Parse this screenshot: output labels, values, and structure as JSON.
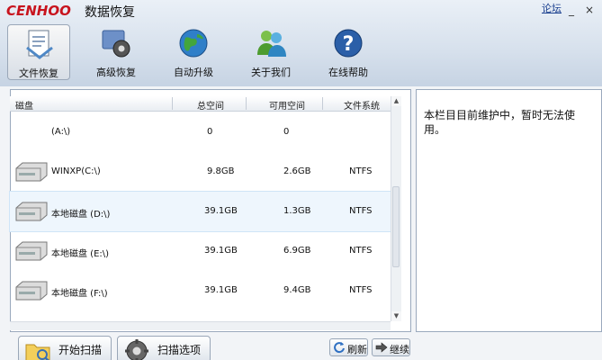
{
  "window": {
    "title": "数据恢复",
    "forum_link": "论坛",
    "logo_text": "CENHOO"
  },
  "window_controls": {
    "minimize": "_",
    "close": "×"
  },
  "toolbar": [
    {
      "label": "文件恢复",
      "icon": "file-recovery-icon",
      "active": true
    },
    {
      "label": "高级恢复",
      "icon": "gear-recovery-icon",
      "active": false
    },
    {
      "label": "自动升级",
      "icon": "globe-icon",
      "active": false
    },
    {
      "label": "关于我们",
      "icon": "users-icon",
      "active": false
    },
    {
      "label": "在线帮助",
      "icon": "help-icon",
      "active": false
    }
  ],
  "drive_table": {
    "columns": [
      "磁盘",
      "总空间",
      "可用空间",
      "文件系统"
    ],
    "rows": [
      {
        "name": "(A:\\)",
        "total": "0",
        "free": "0",
        "fs": ""
      },
      {
        "name": "WINXP(C:\\)",
        "total": "9.8GB",
        "free": "2.6GB",
        "fs": "NTFS"
      },
      {
        "name": "本地磁盘 (D:\\)",
        "total": "39.1GB",
        "free": "1.3GB",
        "fs": "NTFS"
      },
      {
        "name": "本地磁盘 (E:\\)",
        "total": "39.1GB",
        "free": "6.9GB",
        "fs": "NTFS"
      },
      {
        "name": "本地磁盘 (F:\\)",
        "total": "39.1GB",
        "free": "9.4GB",
        "fs": "NTFS"
      }
    ]
  },
  "info": {
    "text": "本栏目目前维护中，暂时无法使用。"
  },
  "buttons": {
    "start_scan": "开始扫描",
    "scan_options": "扫描选项",
    "refresh": "刷新",
    "continue": "继续"
  }
}
